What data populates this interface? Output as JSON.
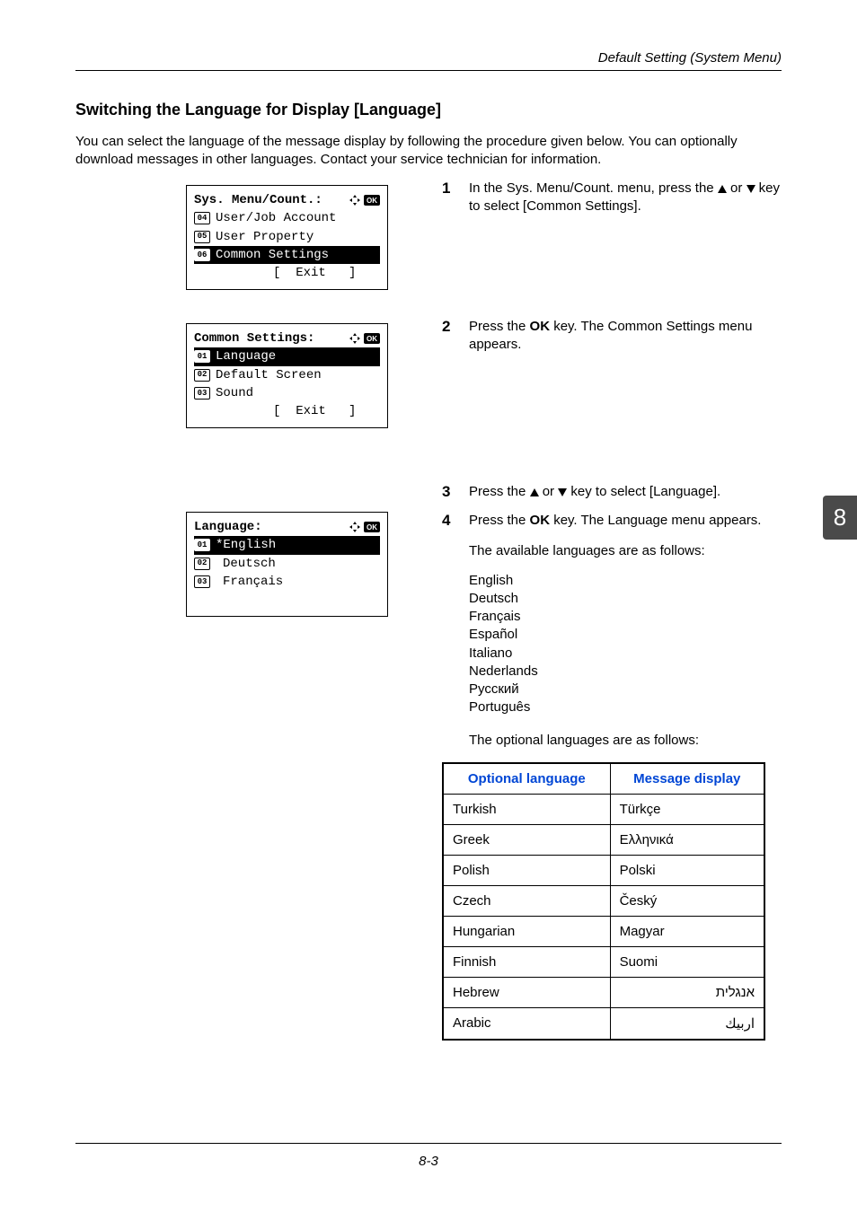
{
  "header": {
    "right_text": "Default Setting (System Menu)"
  },
  "section_title": "Switching the Language for Display [Language]",
  "intro_text": "You can select the language of the message display by following the procedure given below. You can optionally download messages in other languages. Contact your service technician for information.",
  "lcd1": {
    "title": "Sys. Menu/Count.:",
    "items": [
      {
        "num": "04",
        "label": "User/Job Account",
        "selected": false
      },
      {
        "num": "05",
        "label": "User Property",
        "selected": false
      },
      {
        "num": "06",
        "label": "Common Settings",
        "selected": true
      }
    ],
    "footer": "[  Exit   ]"
  },
  "lcd2": {
    "title": "Common Settings:",
    "items": [
      {
        "num": "01",
        "label": "Language",
        "selected": true
      },
      {
        "num": "02",
        "label": "Default Screen",
        "selected": false
      },
      {
        "num": "03",
        "label": "Sound",
        "selected": false
      }
    ],
    "footer": "[  Exit   ]"
  },
  "lcd3": {
    "title": "Language:",
    "items": [
      {
        "num": "01",
        "label": "*English",
        "selected": true
      },
      {
        "num": "02",
        "label": "Deutsch",
        "selected": false
      },
      {
        "num": "03",
        "label": "Français",
        "selected": false
      }
    ]
  },
  "steps": {
    "s1_pre": "In the Sys. Menu/Count. menu, press the ",
    "s1_mid": " or ",
    "s1_post": " key to select [Common Settings].",
    "s2_pre": "Press the ",
    "s2_bold": "OK",
    "s2_post": " key. The Common Settings menu appears.",
    "s3_pre": "Press the ",
    "s3_mid": " or ",
    "s3_post": " key to select [Language].",
    "s4_pre": "Press the ",
    "s4_bold": "OK",
    "s4_post": " key. The Language menu appears.",
    "avail_label": "The available languages are as follows:",
    "opt_label": "The optional languages are as follows:"
  },
  "languages": [
    "English",
    "Deutsch",
    "Français",
    "Español",
    "Italiano",
    "Nederlands",
    "Русский",
    "Português"
  ],
  "opt_table": {
    "head_lang": "Optional language",
    "head_disp": "Message display",
    "rows": [
      {
        "lang": "Turkish",
        "disp": "Türkçe",
        "rtl": false
      },
      {
        "lang": "Greek",
        "disp": "Ελληνικά",
        "rtl": false
      },
      {
        "lang": "Polish",
        "disp": "Polski",
        "rtl": false
      },
      {
        "lang": "Czech",
        "disp": "Český",
        "rtl": false
      },
      {
        "lang": "Hungarian",
        "disp": "Magyar",
        "rtl": false
      },
      {
        "lang": "Finnish",
        "disp": "Suomi",
        "rtl": false
      },
      {
        "lang": "Hebrew",
        "disp": "אנגלית",
        "rtl": true
      },
      {
        "lang": "Arabic",
        "disp": "اربيك",
        "rtl": true
      }
    ]
  },
  "tab_number": "8",
  "footer_page": "8-3"
}
